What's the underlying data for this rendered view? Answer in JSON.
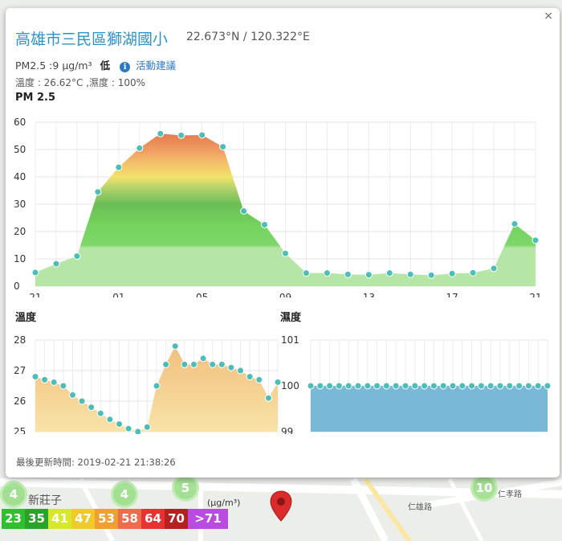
{
  "station": {
    "name": "高雄市三民區獅湖國小",
    "coords": "22.673°N / 120.322°E",
    "pm25_text": "PM2.5 :9 μg/m³",
    "level": "低",
    "advice_label": "活動建議",
    "temp_humidity_text": "溫度 : 26.62°C ,濕度 : 100%",
    "updated_text": "最後更新時間: 2019-02-21 21:38:26",
    "close_label": "×"
  },
  "charts_text": {
    "pm_title": "PM 2.5",
    "temp_title": "溫度",
    "hum_title": "濕度"
  },
  "chart_data": [
    {
      "id": "pm25",
      "type": "area",
      "title": "PM 2.5",
      "x_tick_labels": [
        "21",
        "01",
        "05",
        "09",
        "13",
        "17",
        "21"
      ],
      "y_ticks": [
        0,
        10,
        20,
        30,
        40,
        50,
        60
      ],
      "ylim": [
        0,
        60
      ],
      "grid": true,
      "values": [
        5,
        8.2,
        11,
        34.5,
        43.5,
        50.5,
        55.8,
        55.2,
        55.3,
        51,
        27.5,
        22.5,
        12,
        4.8,
        4.8,
        4.3,
        4.2,
        4.8,
        4.3,
        4,
        4.6,
        4.9,
        6.5,
        22.8,
        16.8
      ]
    },
    {
      "id": "temperature",
      "type": "area",
      "title": "溫度",
      "y_ticks": [
        25,
        26,
        27,
        28
      ],
      "ylim": [
        25,
        28
      ],
      "grid": true,
      "values": [
        26.8,
        26.7,
        26.62,
        26.5,
        26.2,
        26.0,
        25.8,
        25.6,
        25.4,
        25.25,
        25.1,
        25.0,
        25.15,
        26.5,
        27.2,
        27.8,
        27.2,
        27.2,
        27.4,
        27.2,
        27.2,
        27.1,
        27.0,
        26.8,
        26.7,
        26.1,
        26.62
      ]
    },
    {
      "id": "humidity",
      "type": "area",
      "title": "濕度",
      "y_ticks": [
        99,
        100,
        101
      ],
      "ylim": [
        99,
        101
      ],
      "grid": true,
      "values": [
        100,
        100,
        100,
        100,
        100,
        100,
        100,
        100,
        100,
        100,
        100,
        100,
        100,
        100,
        100,
        100,
        100,
        100,
        100,
        100,
        100,
        100,
        100,
        100,
        100,
        100
      ]
    }
  ],
  "legend": {
    "units": "(μg/m³)",
    "items": [
      {
        "label": "23",
        "color": "#2fbf2f"
      },
      {
        "label": "35",
        "color": "#29a329"
      },
      {
        "label": "41",
        "color": "#d6e82a"
      },
      {
        "label": "47",
        "color": "#f0c92a"
      },
      {
        "label": "53",
        "color": "#f0a030"
      },
      {
        "label": "58",
        "color": "#ee6b4d"
      },
      {
        "label": "64",
        "color": "#e83232"
      },
      {
        "label": "70",
        "color": "#b52020"
      },
      {
        "label": ">71",
        "color": "#b94be0"
      }
    ]
  },
  "map": {
    "place_label": "新莊子",
    "road_label_1": "仁雄路",
    "road_label_2": "仁孝路",
    "clusters": [
      "4",
      "4",
      "5",
      "10"
    ]
  },
  "colors": {
    "accent": "#2b93c8",
    "point": "#4dbdb8",
    "pm_fill_low": "#b8e6a8",
    "temp_fill": "#f6d9a0",
    "hum_fill": "#7ab8d8"
  }
}
